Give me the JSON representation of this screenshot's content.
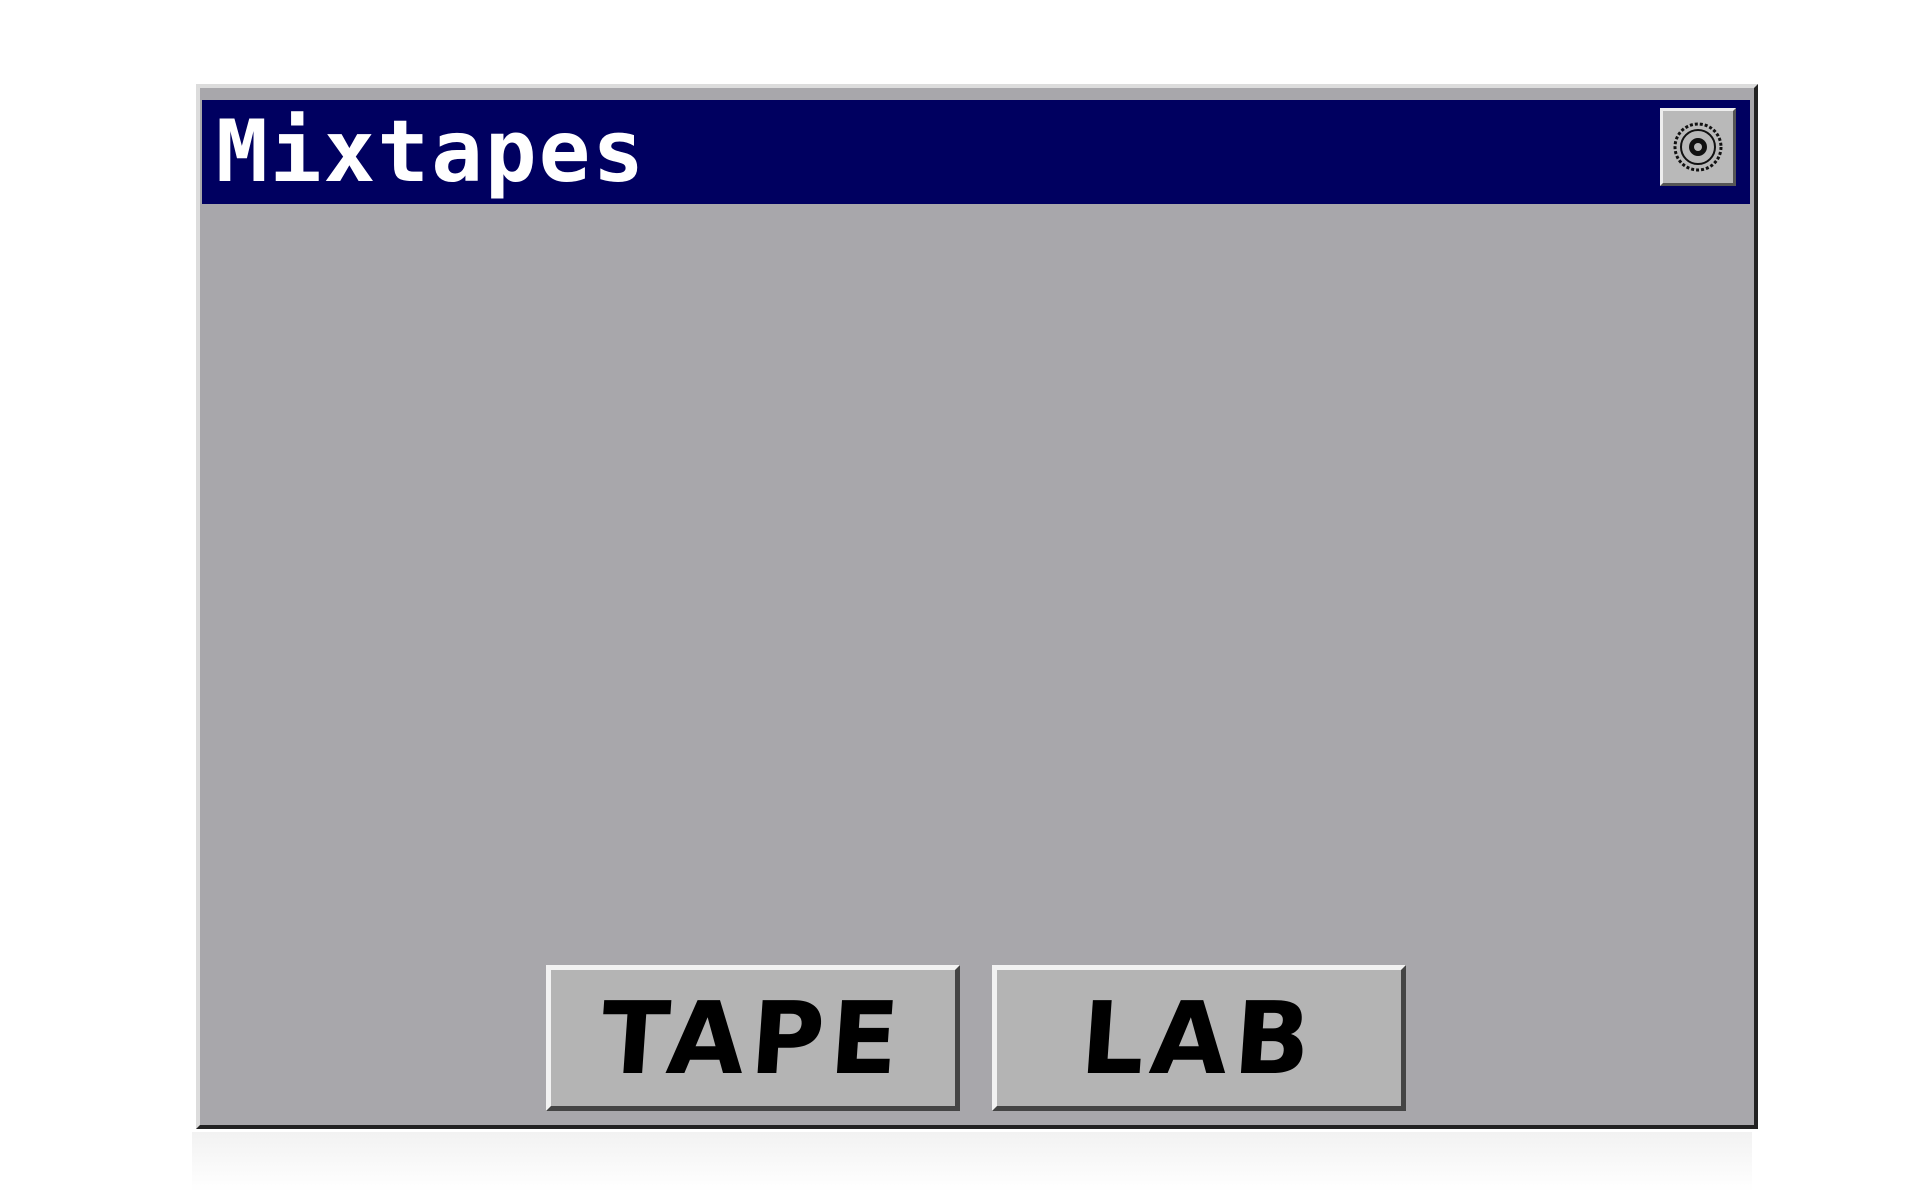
{
  "window": {
    "title": "Mixtapes",
    "settings_icon": "gear-icon"
  },
  "buttons": {
    "tape_label": "TAPE",
    "lab_label": "LAB"
  },
  "colors": {
    "titlebar": "#000060",
    "window_bg": "#a8a7ab",
    "button_bg": "#b4b4b4",
    "title_text": "#ffffff"
  }
}
